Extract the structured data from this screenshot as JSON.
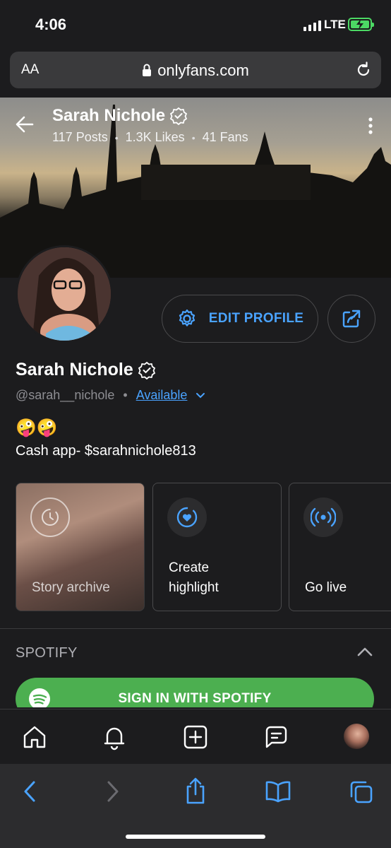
{
  "status_bar": {
    "time": "4:06",
    "network": "LTE"
  },
  "browser": {
    "text_size_label": "AA",
    "url": "onlyfans.com"
  },
  "cover": {
    "name": "Sarah Nichole",
    "stats": {
      "posts": "117 Posts",
      "likes": "1.3K Likes",
      "fans": "41 Fans"
    }
  },
  "profile": {
    "edit_label": "EDIT PROFILE",
    "name": "Sarah Nichole",
    "handle": "@sarah__nichole",
    "availability": "Available",
    "emojis": "🤪🤪",
    "bio": "Cash app- $sarahnichole813"
  },
  "highlights": [
    {
      "label": "Story archive",
      "icon": "clock-icon"
    },
    {
      "label": "Create highlight",
      "icon": "heart-circle-icon"
    },
    {
      "label": "Go live",
      "icon": "broadcast-icon"
    }
  ],
  "spotify": {
    "title": "SPOTIFY",
    "button_label": "SIGN IN WITH SPOTIFY"
  },
  "colors": {
    "accent": "#4aa3ff",
    "spotify_green": "#4caf50",
    "background": "#1c1c1e"
  }
}
